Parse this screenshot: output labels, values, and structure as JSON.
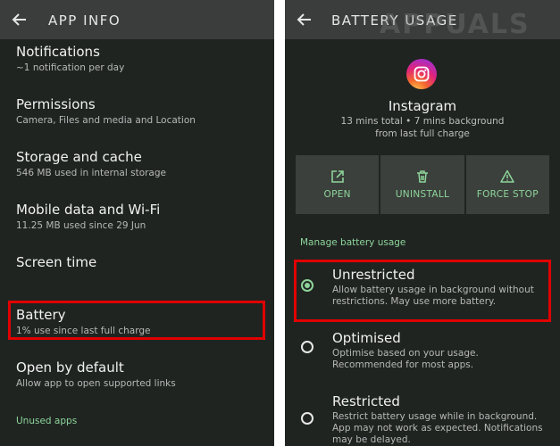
{
  "left": {
    "title": "APP INFO",
    "items": [
      {
        "title": "Notifications",
        "sub": "~1 notification per day"
      },
      {
        "title": "Permissions",
        "sub": "Camera, Files and media and Location"
      },
      {
        "title": "Storage and cache",
        "sub": "546 MB used in internal storage"
      },
      {
        "title": "Mobile data and Wi-Fi",
        "sub": "11.25 MB used since 29 Jun"
      },
      {
        "title": "Screen time",
        "sub": ""
      },
      {
        "title": "Battery",
        "sub": "1% use since last full charge"
      },
      {
        "title": "Open by default",
        "sub": "Allow app to open supported links"
      }
    ],
    "unused_apps_label": "Unused apps"
  },
  "right": {
    "title": "BATTERY USAGE",
    "watermark": "APPUALS",
    "app_name": "Instagram",
    "usage_line1": "13 mins total • 7 mins background",
    "usage_line2": "from last full charge",
    "actions": [
      {
        "label": "OPEN",
        "icon": "open-external-icon"
      },
      {
        "label": "UNINSTALL",
        "icon": "trash-icon"
      },
      {
        "label": "FORCE STOP",
        "icon": "warning-icon"
      }
    ],
    "manage_label": "Manage battery usage",
    "options": [
      {
        "title": "Unrestricted",
        "desc": "Allow battery usage in background without restrictions. May use more battery.",
        "selected": true
      },
      {
        "title": "Optimised",
        "desc": "Optimise based on your usage. Recommended for most apps.",
        "selected": false
      },
      {
        "title": "Restricted",
        "desc": "Restrict battery usage while in background. App may not work as expected. Notifications may be delayed.",
        "selected": false
      }
    ]
  },
  "colors": {
    "background": "#1f2421",
    "topbar": "#3a3d3b",
    "accent_green": "#8ed49a",
    "highlight_red": "#e00000"
  }
}
